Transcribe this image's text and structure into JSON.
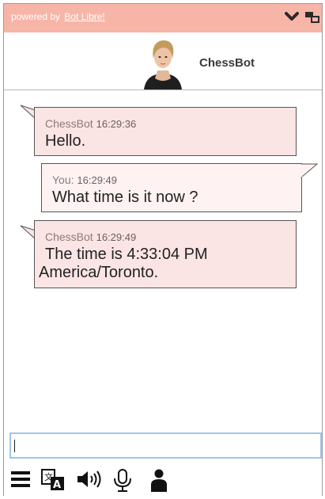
{
  "topbar": {
    "powered_by": "powered by",
    "brand": "Bot Libre!",
    "colors": {
      "bar": "#f7b5a8"
    }
  },
  "header": {
    "bot_name": "ChessBot",
    "avatar_icon": "avatar"
  },
  "chat": {
    "messages": [
      {
        "sender": "ChessBot",
        "time": "16:29:36",
        "text": "Hello.",
        "from": "bot"
      },
      {
        "sender": "You:",
        "time": "16:29:49",
        "text": "What time is it now ?",
        "from": "user"
      },
      {
        "sender": "ChessBot",
        "time": "16:29:49",
        "text_line1": "The time is 4:33:04 PM",
        "text_line2": "America/Toronto.",
        "from": "bot"
      }
    ]
  },
  "input": {
    "value": "",
    "placeholder": ""
  },
  "toolbar": {
    "icons": [
      "menu-icon",
      "translate-icon",
      "speaker-icon",
      "microphone-icon",
      "avatar-toggle-icon"
    ]
  }
}
